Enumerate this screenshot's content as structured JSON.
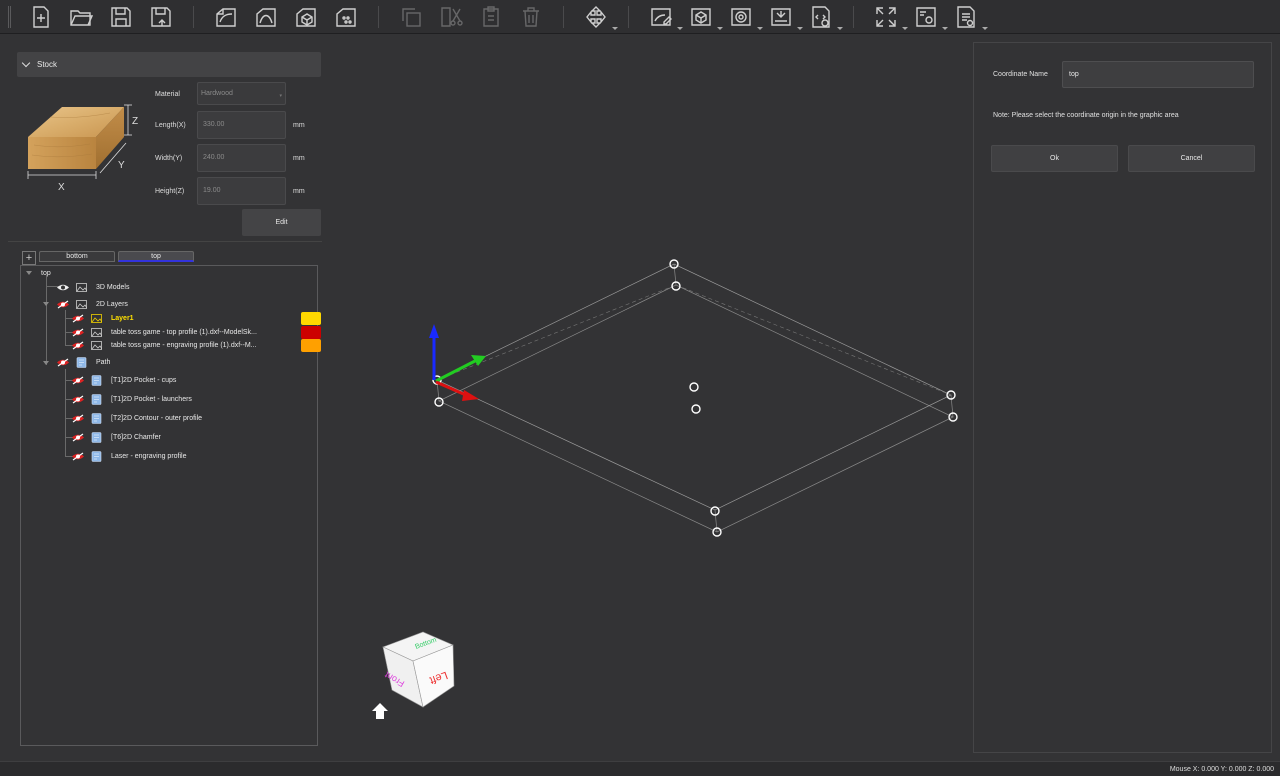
{
  "toolbar": {
    "groups": [
      [
        {
          "icon": "new-file-icon"
        },
        {
          "icon": "open-folder-icon"
        },
        {
          "icon": "save-icon"
        },
        {
          "icon": "save-as-icon"
        }
      ],
      [
        {
          "icon": "import-dxf-icon"
        },
        {
          "icon": "import-curve-icon"
        },
        {
          "icon": "import-model-icon"
        },
        {
          "icon": "import-image-icon"
        }
      ],
      [
        {
          "icon": "copy-icon",
          "disabled": true
        },
        {
          "icon": "cut-icon",
          "disabled": true
        },
        {
          "icon": "paste-icon",
          "disabled": true
        },
        {
          "icon": "delete-icon",
          "disabled": true
        }
      ],
      [
        {
          "icon": "transform-icon",
          "dropdown": true
        }
      ],
      [
        {
          "icon": "edit-2d-icon",
          "dropdown": true
        },
        {
          "icon": "edit-3d-icon",
          "dropdown": true
        },
        {
          "icon": "toolpath-icon",
          "dropdown": true
        },
        {
          "icon": "laser-icon",
          "dropdown": true
        },
        {
          "icon": "gcode-icon",
          "dropdown": true
        }
      ],
      [
        {
          "icon": "fit-view-icon",
          "dropdown": true
        },
        {
          "icon": "settings-icon",
          "dropdown": true
        },
        {
          "icon": "report-icon",
          "dropdown": true
        }
      ]
    ]
  },
  "stock": {
    "title": "Stock",
    "material_label": "Material",
    "material_value": "Hardwood",
    "length_label": "Length(X)",
    "length_value": "330.00",
    "width_label": "Width(Y)",
    "width_value": "240.00",
    "height_label": "Height(Z)",
    "height_value": "19.00",
    "unit": "mm",
    "edit_label": "Edit",
    "axis_x": "X",
    "axis_y": "Y",
    "axis_z": "Z"
  },
  "tabs": {
    "plus": "+",
    "bottom": "bottom",
    "top": "top"
  },
  "tree": {
    "root": "top",
    "models": "3D Models",
    "layers": "2D Layers",
    "layer1": "Layer1",
    "layer_top_profile": "table toss game - top profile (1).dxf--ModelSk...",
    "layer_engraving": "table toss game - engraving profile (1).dxf--M...",
    "path": "Path",
    "path_items": [
      "[T1]2D Pocket - cups",
      "[T1]2D Pocket - launchers",
      "[T2]2D Contour - outer profile",
      "[T6]2D Chamfer",
      "Laser - engraving profile"
    ],
    "swatch_colors": [
      "#ffd800",
      "#cc0000",
      "#ffa000"
    ]
  },
  "viewcube": {
    "top": "Bottom",
    "front": "Front",
    "left": "Left"
  },
  "dialog": {
    "coord_label": "Coordinate Name",
    "coord_value": "top",
    "note": "Note: Please select the coordinate origin in the graphic area",
    "ok": "Ok",
    "cancel": "Cancel"
  },
  "status": {
    "mouse": "Mouse X: 0.000 Y: 0.000 Z: 0.000"
  }
}
